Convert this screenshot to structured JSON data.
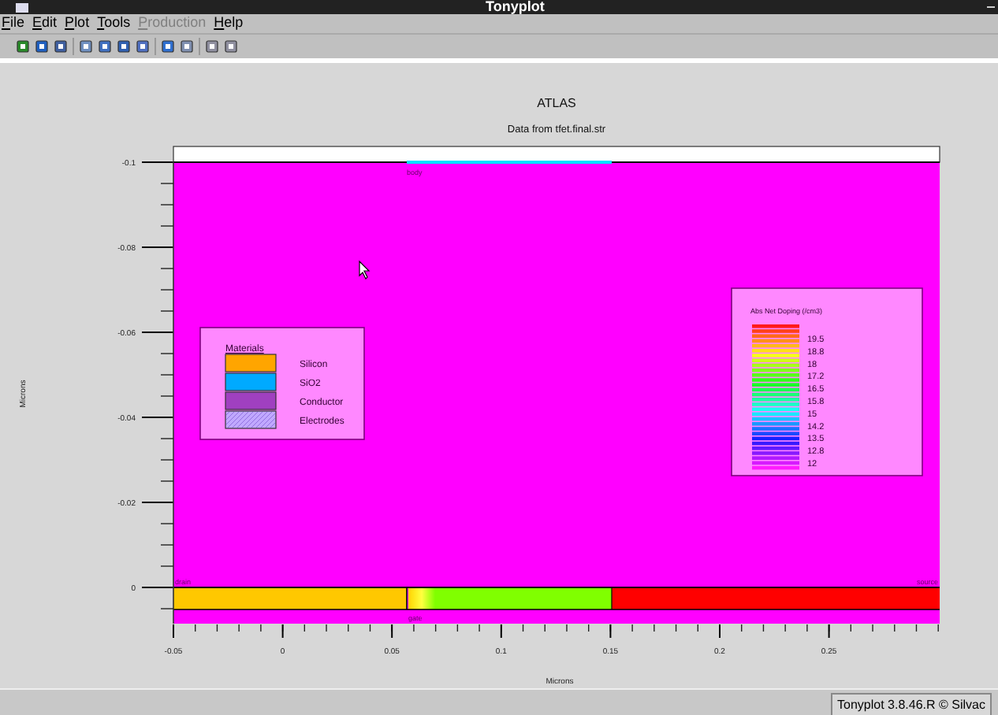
{
  "window": {
    "title": "Tonyplot"
  },
  "menu": [
    {
      "label": "File",
      "disabled": false
    },
    {
      "label": "Edit",
      "disabled": false
    },
    {
      "label": "Plot",
      "disabled": false
    },
    {
      "label": "Tools",
      "disabled": false
    },
    {
      "label": "Production",
      "disabled": true
    },
    {
      "label": "Help",
      "disabled": false
    }
  ],
  "plot": {
    "title": "ATLAS",
    "subtitle": "Data from tfet.final.str",
    "xlabel": "Microns",
    "ylabel": "Microns",
    "xticks": [
      "-0.05",
      "0",
      "0.05",
      "0.1",
      "0.15",
      "0.2",
      "0.25"
    ],
    "yticks": [
      "-0.1",
      "-0.08",
      "-0.06",
      "-0.04",
      "-0.02",
      "0"
    ],
    "region_labels": [
      {
        "kind": "top",
        "text": "body"
      },
      {
        "kind": "left",
        "text": "drain"
      },
      {
        "kind": "right",
        "text": "source"
      },
      {
        "kind": "bottom",
        "text": "gate"
      }
    ],
    "materials_legend": {
      "title": "Materials",
      "items": [
        {
          "label": "Silicon",
          "color": "#ffa500",
          "kind": "solid"
        },
        {
          "label": "SiO2",
          "color": "#00aaff",
          "kind": "solid"
        },
        {
          "label": "Conductor",
          "color": "#a040c0",
          "kind": "solid"
        },
        {
          "label": "Electrodes",
          "color": "#c0a8ff",
          "kind": "hatched"
        }
      ]
    },
    "doping_legend": {
      "title": "Abs Net Doping (/cm3)",
      "labels": [
        "19.5",
        "18.8",
        "18",
        "17.2",
        "16.5",
        "15.8",
        "15",
        "14.2",
        "13.5",
        "12.8",
        "12"
      ]
    }
  },
  "status_bar": {
    "text": "Tonyplot 3.8.46.R © Silvac"
  }
}
